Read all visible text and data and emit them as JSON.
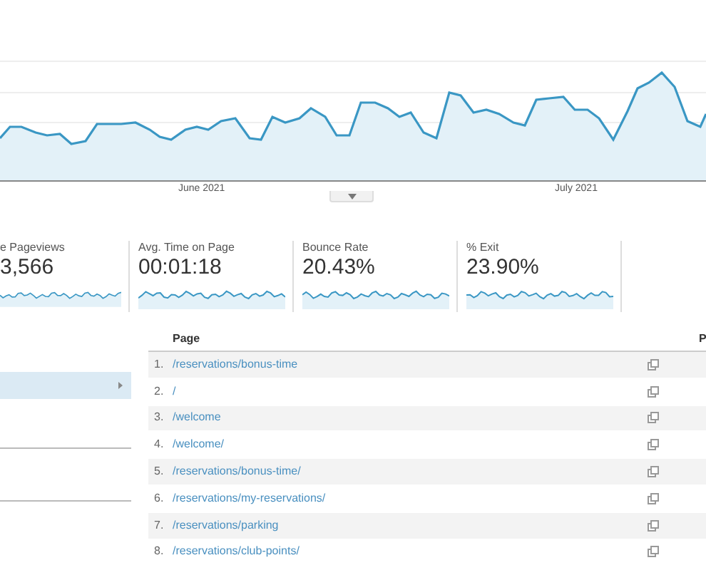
{
  "main_chart": {
    "x_labels": [
      "June 2021",
      "July 2021"
    ]
  },
  "metrics": [
    {
      "label": "e Pageviews",
      "value": "3,566"
    },
    {
      "label": "Avg. Time on Page",
      "value": "00:01:18"
    },
    {
      "label": "Bounce Rate",
      "value": "20.43%"
    },
    {
      "label": "% Exit",
      "value": "23.90%"
    }
  ],
  "sidebar": {
    "items": [
      {
        "selected": true
      }
    ]
  },
  "table": {
    "columns": [
      "Page",
      "P"
    ],
    "rows": [
      {
        "index": "1.",
        "page": "/reservations/bonus-time"
      },
      {
        "index": "2.",
        "page": "/"
      },
      {
        "index": "3.",
        "page": "/welcome"
      },
      {
        "index": "4.",
        "page": "/welcome/"
      },
      {
        "index": "5.",
        "page": "/reservations/bonus-time/"
      },
      {
        "index": "6.",
        "page": "/reservations/my-reservations/"
      },
      {
        "index": "7.",
        "page": "/reservations/parking"
      },
      {
        "index": "8.",
        "page": "/reservations/club-points/"
      }
    ]
  }
}
